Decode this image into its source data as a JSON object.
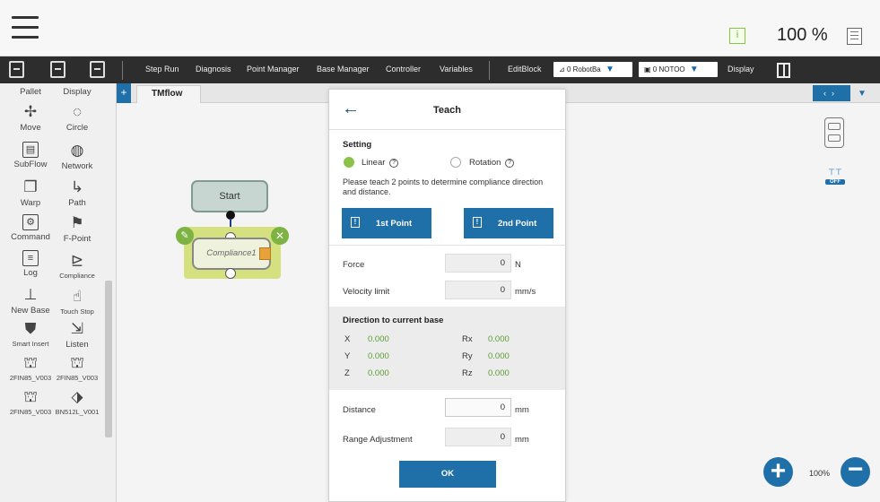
{
  "topbar": {
    "zoom_percent": "100 %",
    "icons": [
      "hamburger-menu-icon",
      "info-icon",
      "notepad-icon"
    ]
  },
  "toolbar": {
    "items": [
      "Step Run",
      "Diagnosis",
      "Point Manager",
      "Base Manager",
      "Controller",
      "Variables",
      "EditBlock"
    ],
    "robot_base": "0 RobotBa",
    "tool": "0 NOTOO",
    "display": "Display"
  },
  "palette": {
    "items": [
      {
        "label": "Pallet",
        "icon": "pallet-icon"
      },
      {
        "label": "Display",
        "icon": "display-icon"
      },
      {
        "label": "Move",
        "icon": "move-icon"
      },
      {
        "label": "Circle",
        "icon": "circle-icon"
      },
      {
        "label": "SubFlow",
        "icon": "subflow-icon"
      },
      {
        "label": "Network",
        "icon": "network-icon"
      },
      {
        "label": "Warp",
        "icon": "warp-icon"
      },
      {
        "label": "Path",
        "icon": "path-icon"
      },
      {
        "label": "Command",
        "icon": "command-icon"
      },
      {
        "label": "F-Point",
        "icon": "f-point-icon"
      },
      {
        "label": "Log",
        "icon": "log-icon"
      },
      {
        "label": "Compliance",
        "icon": "compliance-icon"
      },
      {
        "label": "New Base",
        "icon": "new-base-icon"
      },
      {
        "label": "Touch Stop",
        "icon": "touch-stop-icon"
      },
      {
        "label": "Smart Insert",
        "icon": "smart-insert-icon"
      },
      {
        "label": "Listen",
        "icon": "listen-icon"
      },
      {
        "label": "2FIN85_V003",
        "icon": "gripper-icon"
      },
      {
        "label": "2FIN85_V003",
        "icon": "gripper-icon"
      },
      {
        "label": "2FIN85_V003",
        "icon": "gripper-icon"
      },
      {
        "label": "BN512L_V001",
        "icon": "gripper-icon"
      }
    ]
  },
  "canvas": {
    "tab_label": "TMflow",
    "start_label": "Start",
    "node_label": "Compliance1",
    "zoom_label": "100%",
    "switch_label": "OFF"
  },
  "dialog": {
    "title": "Teach",
    "setting_label": "Setting",
    "linear_label": "Linear",
    "rotation_label": "Rotation",
    "linear_selected": true,
    "description": "Please teach 2 points to determine compliance direction and distance.",
    "first_point": "1st Point",
    "second_point": "2nd Point",
    "force_label": "Force",
    "force_value": "0",
    "force_unit": "N",
    "velocity_label": "Velocity limit",
    "velocity_value": "0",
    "velocity_unit": "mm/s",
    "direction_label": "Direction to current base",
    "direction": {
      "X": "0.000",
      "Y": "0.000",
      "Z": "0.000",
      "Rx": "0.000",
      "Ry": "0.000",
      "Rz": "0.000"
    },
    "distance_label": "Distance",
    "distance_value": "0",
    "distance_unit": "mm",
    "range_label": "Range Adjustment",
    "range_value": "0",
    "range_unit": "mm",
    "ok_label": "OK"
  }
}
